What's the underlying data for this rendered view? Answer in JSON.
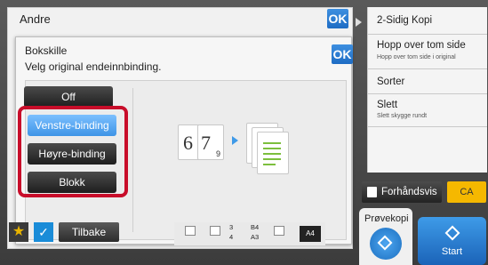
{
  "header": {
    "title": "Andre",
    "ok_label": "OK"
  },
  "right_menu": {
    "items": [
      {
        "label": "2-Sidig Kopi",
        "sublabel": ""
      },
      {
        "label": "Hopp over tom side",
        "sublabel": "Hopp over tom side i original"
      },
      {
        "label": "Sorter",
        "sublabel": ""
      },
      {
        "label": "Slett",
        "sublabel": "Slett skygge rundt"
      }
    ]
  },
  "dialog": {
    "title": "Bokskille",
    "subtitle": "Velg original endeinnbinding.",
    "ok_label": "OK",
    "options": [
      {
        "label": "Off",
        "selected": false
      },
      {
        "label": "Venstre-binding",
        "selected": true
      },
      {
        "label": "Høyre-binding",
        "selected": false
      },
      {
        "label": "Blokk",
        "selected": false
      }
    ],
    "illustration": {
      "page_left": "6",
      "page_right": "7",
      "page_small": "9"
    }
  },
  "bottom": {
    "back_label": "Tilbake",
    "tray": {
      "t1": "3",
      "t2": "4",
      "s1": "B4",
      "s2": "A3",
      "paper": "A4"
    },
    "preview_label": "Forhåndsvis",
    "ca_label": "CA",
    "proof_label": "Prøvekopi",
    "start_label": "Start"
  },
  "colors": {
    "accent": "#3e94e6",
    "highlight": "#c80d2a",
    "ca": "#f5b800"
  }
}
